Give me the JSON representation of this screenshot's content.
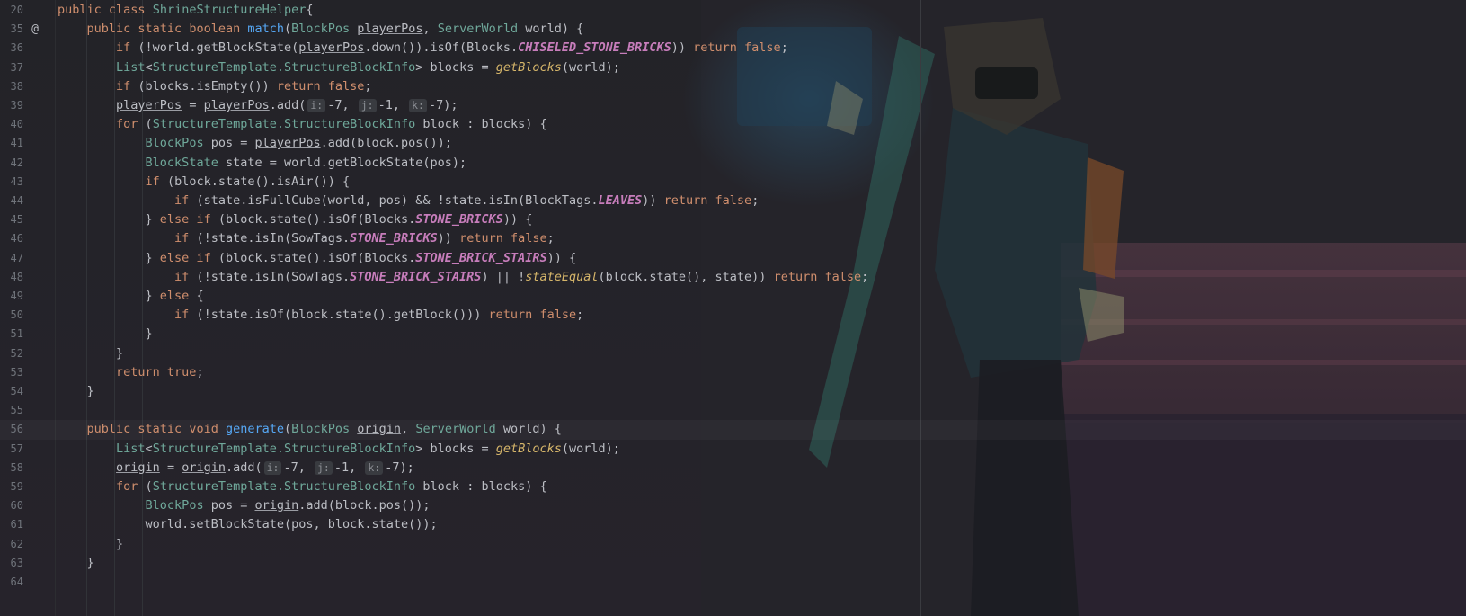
{
  "editor": {
    "lines": [
      {
        "num": "20",
        "mark": "",
        "tokens": [
          [
            "kw",
            "public "
          ],
          [
            "kw",
            "class "
          ],
          [
            "ty",
            "ShrineStructureHelper"
          ],
          [
            "",
            "{"
          ]
        ]
      },
      {
        "num": "35",
        "mark": "@",
        "tokens": [
          [
            "",
            "    "
          ],
          [
            "kw",
            "public "
          ],
          [
            "kw",
            "static "
          ],
          [
            "kw",
            "boolean "
          ],
          [
            "fn",
            "match"
          ],
          [
            "",
            "("
          ],
          [
            "ty",
            "BlockPos "
          ],
          [
            "uvar",
            "playerPos"
          ],
          [
            "",
            ", "
          ],
          [
            "ty",
            "ServerWorld "
          ],
          [
            "",
            "world) {"
          ]
        ]
      },
      {
        "num": "36",
        "mark": "",
        "tokens": [
          [
            "",
            "        "
          ],
          [
            "kw",
            "if "
          ],
          [
            "",
            "(!world.getBlockState("
          ],
          [
            "uvar",
            "playerPos"
          ],
          [
            "",
            ".down()).isOf(Blocks."
          ],
          [
            "st",
            "CHISELED_STONE_BRICKS"
          ],
          [
            "",
            ")) "
          ],
          [
            "kw",
            "return false"
          ],
          [
            "",
            ";"
          ]
        ]
      },
      {
        "num": "37",
        "mark": "",
        "tokens": [
          [
            "",
            "        "
          ],
          [
            "ty",
            "List"
          ],
          [
            "",
            "<"
          ],
          [
            "ty",
            "StructureTemplate.StructureBlockInfo"
          ],
          [
            "",
            "> blocks = "
          ],
          [
            "sfn",
            "getBlocks"
          ],
          [
            "",
            "(world);"
          ]
        ]
      },
      {
        "num": "38",
        "mark": "",
        "tokens": [
          [
            "",
            "        "
          ],
          [
            "kw",
            "if "
          ],
          [
            "",
            "(blocks.isEmpty()) "
          ],
          [
            "kw",
            "return false"
          ],
          [
            "",
            ";"
          ]
        ]
      },
      {
        "num": "39",
        "mark": "",
        "tokens": [
          [
            "",
            "        "
          ],
          [
            "uvar",
            "playerPos"
          ],
          [
            "",
            " = "
          ],
          [
            "uvar",
            "playerPos"
          ],
          [
            "",
            ".add("
          ],
          [
            "hint",
            "i:"
          ],
          [
            "",
            "-7, "
          ],
          [
            "hint",
            "j:"
          ],
          [
            "",
            "-1, "
          ],
          [
            "hint",
            "k:"
          ],
          [
            "",
            "-7);"
          ]
        ]
      },
      {
        "num": "40",
        "mark": "",
        "tokens": [
          [
            "",
            "        "
          ],
          [
            "kw",
            "for "
          ],
          [
            "",
            "("
          ],
          [
            "ty",
            "StructureTemplate.StructureBlockInfo "
          ],
          [
            "",
            "block : blocks) {"
          ]
        ]
      },
      {
        "num": "41",
        "mark": "",
        "tokens": [
          [
            "",
            "            "
          ],
          [
            "ty",
            "BlockPos "
          ],
          [
            "",
            "pos = "
          ],
          [
            "uvar",
            "playerPos"
          ],
          [
            "",
            ".add(block.pos());"
          ]
        ]
      },
      {
        "num": "42",
        "mark": "",
        "tokens": [
          [
            "",
            "            "
          ],
          [
            "ty",
            "BlockState "
          ],
          [
            "",
            "state = world.getBlockState(pos);"
          ]
        ]
      },
      {
        "num": "43",
        "mark": "",
        "tokens": [
          [
            "",
            "            "
          ],
          [
            "kw",
            "if "
          ],
          [
            "",
            "(block.state().isAir()) {"
          ]
        ]
      },
      {
        "num": "44",
        "mark": "",
        "tokens": [
          [
            "",
            "                "
          ],
          [
            "kw",
            "if "
          ],
          [
            "",
            "(state.isFullCube(world, pos) && !state.isIn(BlockTags."
          ],
          [
            "st",
            "LEAVES"
          ],
          [
            "",
            ")) "
          ],
          [
            "kw",
            "return false"
          ],
          [
            "",
            ";"
          ]
        ]
      },
      {
        "num": "45",
        "mark": "",
        "tokens": [
          [
            "",
            "            } "
          ],
          [
            "kw",
            "else if "
          ],
          [
            "",
            "(block.state().isOf(Blocks."
          ],
          [
            "st",
            "STONE_BRICKS"
          ],
          [
            "",
            ")) {"
          ]
        ]
      },
      {
        "num": "46",
        "mark": "",
        "tokens": [
          [
            "",
            "                "
          ],
          [
            "kw",
            "if "
          ],
          [
            "",
            "(!state.isIn(SowTags."
          ],
          [
            "st",
            "STONE_BRICKS"
          ],
          [
            "",
            ")) "
          ],
          [
            "kw",
            "return false"
          ],
          [
            "",
            ";"
          ]
        ]
      },
      {
        "num": "47",
        "mark": "",
        "tokens": [
          [
            "",
            "            } "
          ],
          [
            "kw",
            "else if "
          ],
          [
            "",
            "(block.state().isOf(Blocks."
          ],
          [
            "st",
            "STONE_BRICK_STAIRS"
          ],
          [
            "",
            ")) {"
          ]
        ]
      },
      {
        "num": "48",
        "mark": "",
        "tokens": [
          [
            "",
            "                "
          ],
          [
            "kw",
            "if "
          ],
          [
            "",
            "(!state.isIn(SowTags."
          ],
          [
            "st",
            "STONE_BRICK_STAIRS"
          ],
          [
            "",
            ") || !"
          ],
          [
            "sfn",
            "stateEqual"
          ],
          [
            "",
            "(block.state(), state)) "
          ],
          [
            "kw",
            "return false"
          ],
          [
            "",
            ";"
          ]
        ]
      },
      {
        "num": "49",
        "mark": "",
        "tokens": [
          [
            "",
            "            } "
          ],
          [
            "kw",
            "else "
          ],
          [
            "",
            "{"
          ]
        ]
      },
      {
        "num": "50",
        "mark": "",
        "tokens": [
          [
            "",
            "                "
          ],
          [
            "kw",
            "if "
          ],
          [
            "",
            "(!state.isOf(block.state().getBlock())) "
          ],
          [
            "kw",
            "return false"
          ],
          [
            "",
            ";"
          ]
        ]
      },
      {
        "num": "51",
        "mark": "",
        "tokens": [
          [
            "",
            "            }"
          ]
        ]
      },
      {
        "num": "52",
        "mark": "",
        "tokens": [
          [
            "",
            "        }"
          ]
        ]
      },
      {
        "num": "53",
        "mark": "",
        "tokens": [
          [
            "",
            "        "
          ],
          [
            "kw",
            "return true"
          ],
          [
            "",
            ";"
          ]
        ]
      },
      {
        "num": "54",
        "mark": "",
        "tokens": [
          [
            "",
            "    }"
          ]
        ]
      },
      {
        "num": "55",
        "mark": "",
        "tokens": []
      },
      {
        "num": "56",
        "mark": "",
        "current": true,
        "tokens": [
          [
            "",
            "    "
          ],
          [
            "kw",
            "public "
          ],
          [
            "kw",
            "static "
          ],
          [
            "kw",
            "void "
          ],
          [
            "fn",
            "generate"
          ],
          [
            "",
            "("
          ],
          [
            "ty",
            "BlockPos "
          ],
          [
            "uvar",
            "origin"
          ],
          [
            "",
            ", "
          ],
          [
            "ty",
            "ServerWorld "
          ],
          [
            "",
            "world) {"
          ]
        ]
      },
      {
        "num": "57",
        "mark": "",
        "tokens": [
          [
            "",
            "        "
          ],
          [
            "ty",
            "List"
          ],
          [
            "",
            "<"
          ],
          [
            "ty",
            "StructureTemplate.StructureBlockInfo"
          ],
          [
            "",
            "> blocks = "
          ],
          [
            "sfn",
            "getBlocks"
          ],
          [
            "",
            "(world);"
          ]
        ]
      },
      {
        "num": "58",
        "mark": "",
        "tokens": [
          [
            "",
            "        "
          ],
          [
            "uvar",
            "origin"
          ],
          [
            "",
            " = "
          ],
          [
            "uvar",
            "origin"
          ],
          [
            "",
            ".add("
          ],
          [
            "hint",
            "i:"
          ],
          [
            "",
            "-7, "
          ],
          [
            "hint",
            "j:"
          ],
          [
            "",
            "-1, "
          ],
          [
            "hint",
            "k:"
          ],
          [
            "",
            "-7);"
          ]
        ]
      },
      {
        "num": "59",
        "mark": "",
        "tokens": [
          [
            "",
            "        "
          ],
          [
            "kw",
            "for "
          ],
          [
            "",
            "("
          ],
          [
            "ty",
            "StructureTemplate.StructureBlockInfo "
          ],
          [
            "",
            "block : blocks) {"
          ]
        ]
      },
      {
        "num": "60",
        "mark": "",
        "tokens": [
          [
            "",
            "            "
          ],
          [
            "ty",
            "BlockPos "
          ],
          [
            "",
            "pos = "
          ],
          [
            "uvar",
            "origin"
          ],
          [
            "",
            ".add(block.pos());"
          ]
        ]
      },
      {
        "num": "61",
        "mark": "",
        "tokens": [
          [
            "",
            "            world.setBlockState(pos, block.state());"
          ]
        ]
      },
      {
        "num": "62",
        "mark": "",
        "tokens": [
          [
            "",
            "        }"
          ]
        ]
      },
      {
        "num": "63",
        "mark": "",
        "tokens": [
          [
            "",
            "    }"
          ]
        ]
      },
      {
        "num": "64",
        "mark": "",
        "tokens": []
      }
    ]
  },
  "colors": {
    "background": "#1e1f22",
    "keyword": "#cf8e6d",
    "type": "#6fa89a",
    "method_decl": "#56a8f5",
    "static_field": "#c77dbb",
    "static_method": "#d6b66a",
    "default_text": "#bcbec4",
    "line_number": "#6f737a"
  },
  "background_art": {
    "description_icon": "anime-character-wallpaper"
  }
}
